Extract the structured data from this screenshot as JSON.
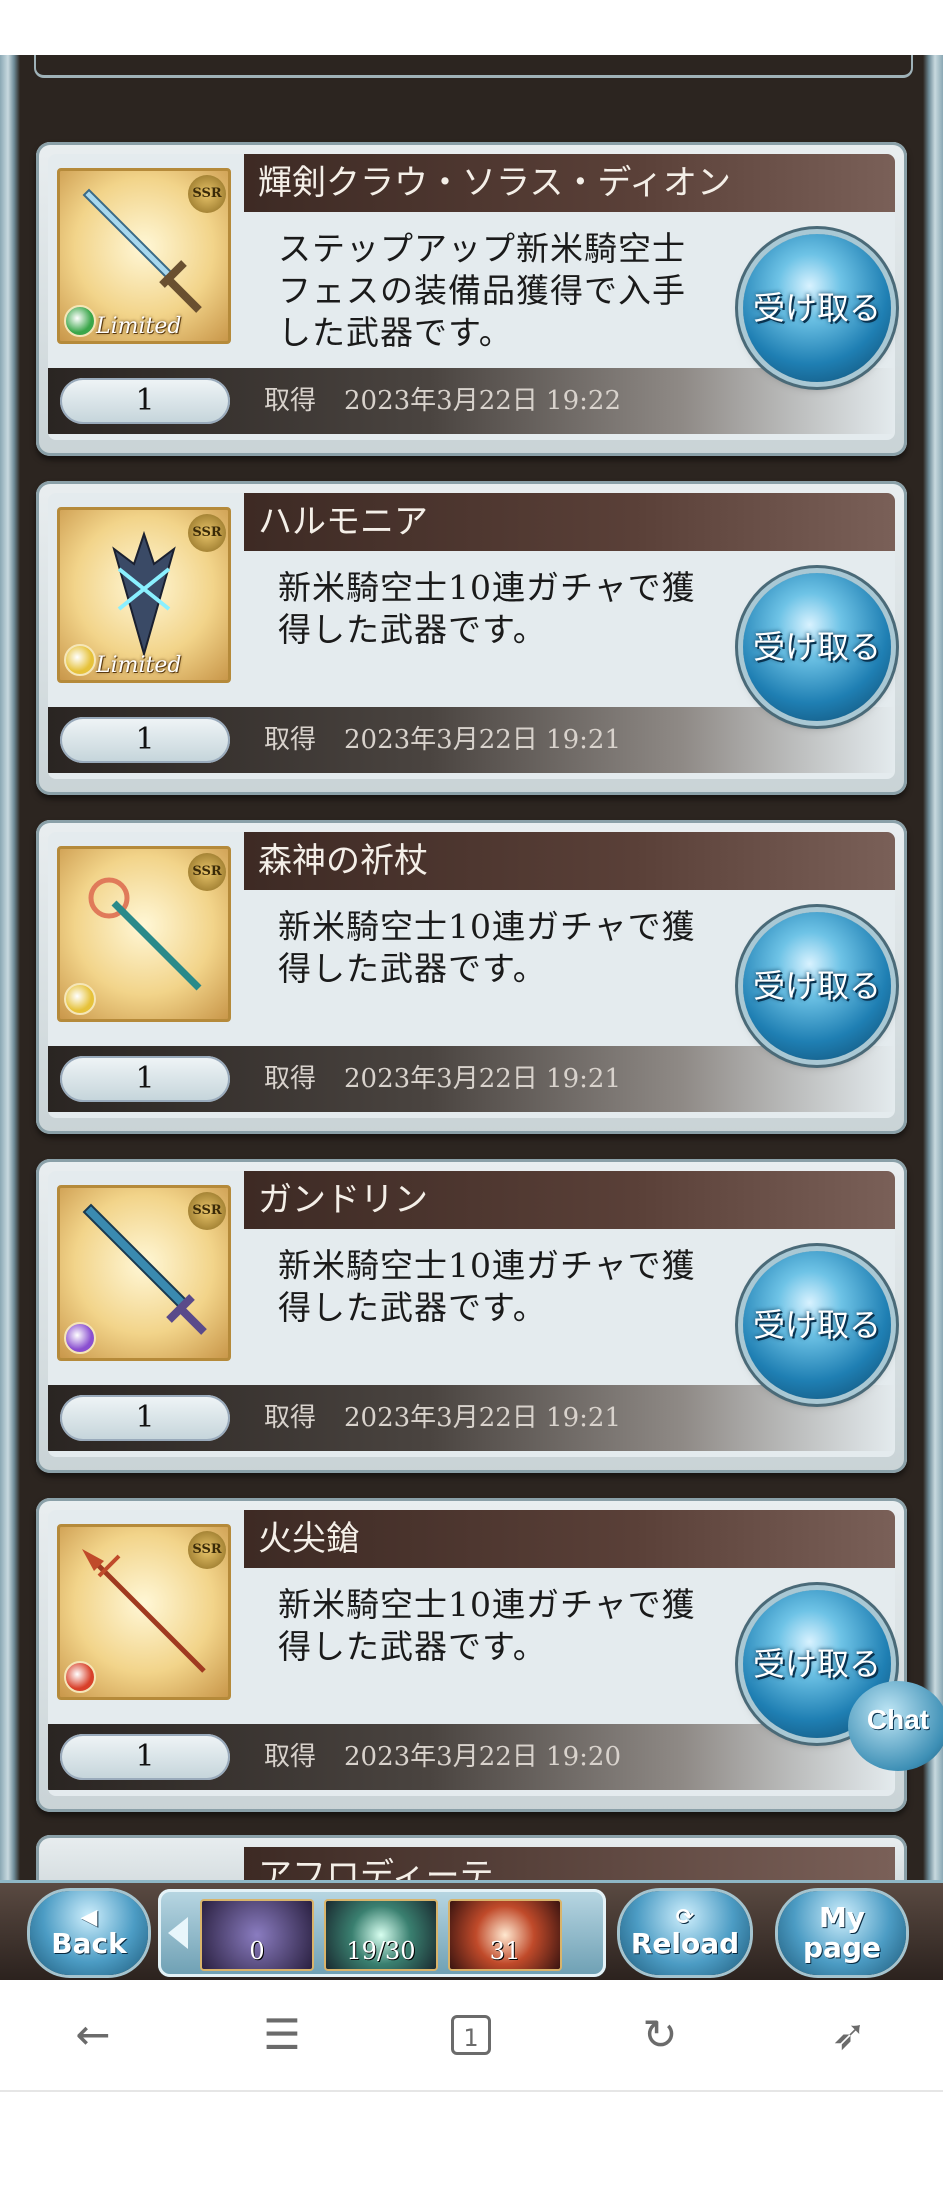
{
  "items": [
    {
      "name": "輝剣クラウ・ソラス・ディオン",
      "rarity": "SSR",
      "limited": "Limited",
      "element_color": "#3aa64a",
      "desc_lines": [
        "ステップアップ新米騎空士",
        "フェスの装備品獲得で入手",
        "した武器です。"
      ],
      "qty": "1",
      "acquired_label": "取得",
      "date": "2023年3月22日 19:22",
      "button": "受け取る"
    },
    {
      "name": "ハルモニア",
      "rarity": "SSR",
      "limited": "Limited",
      "element_color": "#e6c23a",
      "desc_lines": [
        "新米騎空士10連ガチャで獲",
        "得した武器です。"
      ],
      "qty": "1",
      "acquired_label": "取得",
      "date": "2023年3月22日 19:21",
      "button": "受け取る"
    },
    {
      "name": "森神の祈杖",
      "rarity": "SSR",
      "limited": "",
      "element_color": "#e6c23a",
      "desc_lines": [
        "新米騎空士10連ガチャで獲",
        "得した武器です。"
      ],
      "qty": "1",
      "acquired_label": "取得",
      "date": "2023年3月22日 19:21",
      "button": "受け取る"
    },
    {
      "name": "ガンドリン",
      "rarity": "SSR",
      "limited": "",
      "element_color": "#8a4fd0",
      "desc_lines": [
        "新米騎空士10連ガチャで獲",
        "得した武器です。"
      ],
      "qty": "1",
      "acquired_label": "取得",
      "date": "2023年3月22日 19:21",
      "button": "受け取る"
    },
    {
      "name": "火尖鎗",
      "rarity": "SSR",
      "limited": "",
      "element_color": "#d8402a",
      "desc_lines": [
        "新米騎空士10連ガチャで獲",
        "得した武器です。"
      ],
      "qty": "1",
      "acquired_label": "取得",
      "date": "2023年3月22日 19:20",
      "button": "受け取る"
    }
  ],
  "partial_item": {
    "name": "アフロディーテ"
  },
  "chat": {
    "label": "Chat"
  },
  "nav": {
    "back": [
      "Back"
    ],
    "reload": [
      "Reload"
    ],
    "mypage": [
      "My",
      "page"
    ],
    "tray": [
      "0",
      "19/30",
      "31"
    ]
  },
  "browser": {
    "tab_count": "1"
  }
}
